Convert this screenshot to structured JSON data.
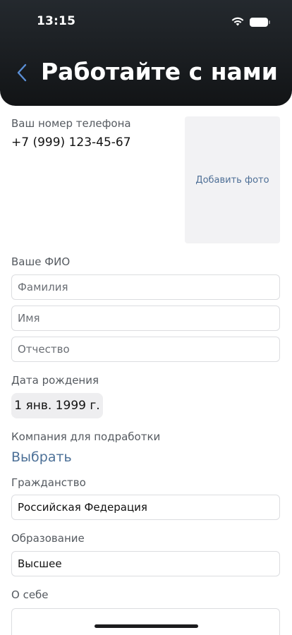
{
  "status_bar": {
    "time": "13:15",
    "wifi_icon": "wifi-icon",
    "battery_icon": "battery-icon"
  },
  "header": {
    "title": "Работайте с нами",
    "back_icon": "chevron-left-icon"
  },
  "phone": {
    "label": "Ваш номер телефона",
    "value": "+7 (999) 123-45-67"
  },
  "photo": {
    "button_label": "Добавить фото"
  },
  "fio": {
    "label": "Ваше ФИО",
    "last_name_placeholder": "Фамилия",
    "first_name_placeholder": "Имя",
    "patronymic_placeholder": "Отчество"
  },
  "birth_date": {
    "label": "Дата рождения",
    "value": "1 янв. 1999 г."
  },
  "company": {
    "label": "Компания для подработки",
    "select_label": "Выбрать"
  },
  "citizenship": {
    "label": "Гражданство",
    "value": "Российская Федерация"
  },
  "education": {
    "label": "Образование",
    "value": "Высшее"
  },
  "about": {
    "label": "О себе"
  },
  "colors": {
    "header_bg": "#1e2226",
    "accent": "#4c7097",
    "field_border": "#dcdde0"
  }
}
